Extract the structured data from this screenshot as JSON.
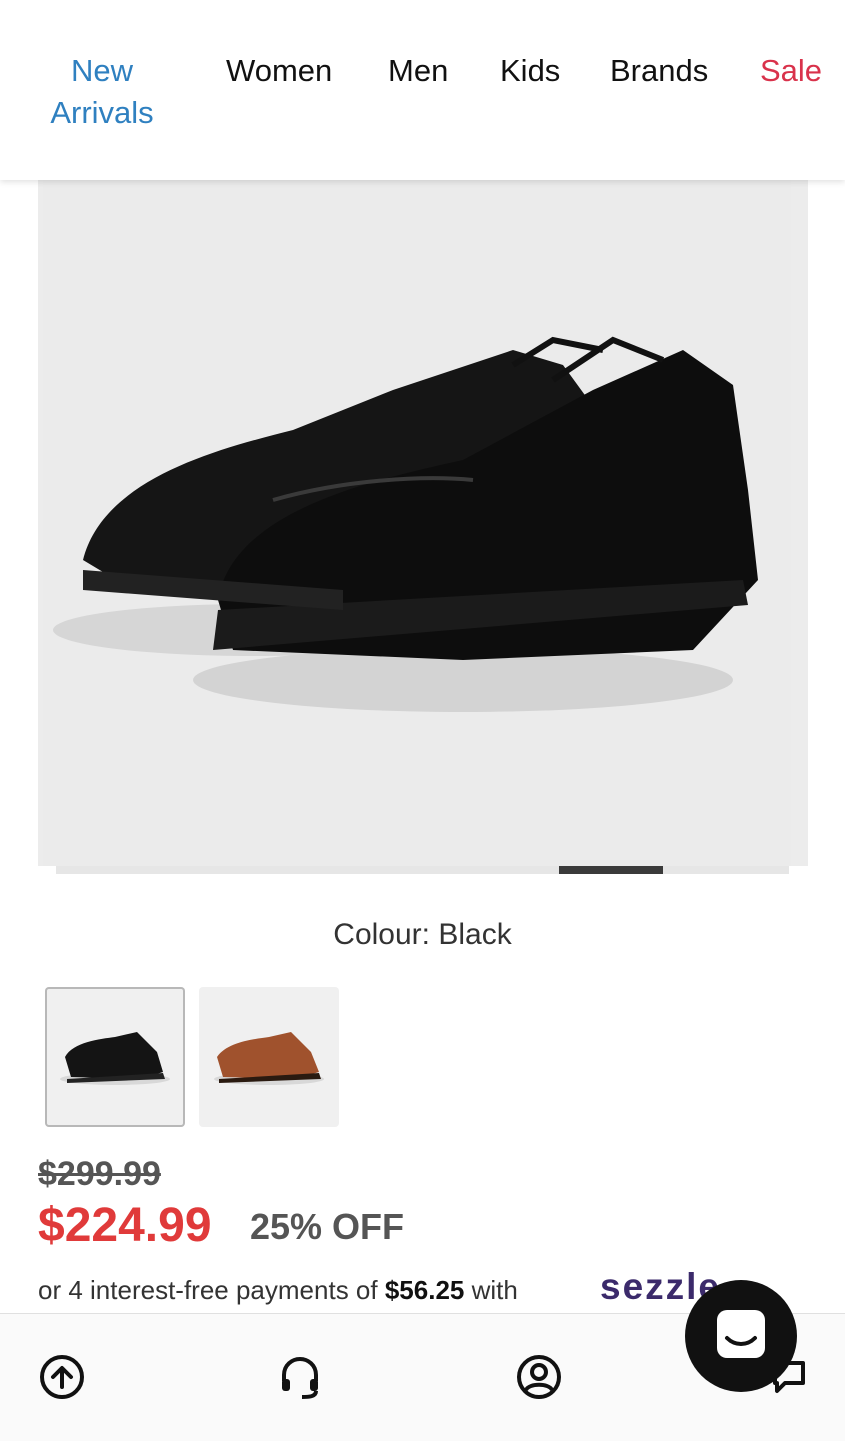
{
  "nav": {
    "items": [
      "New Arrivals",
      "Women",
      "Men",
      "Kids",
      "Brands",
      "Sale"
    ]
  },
  "product": {
    "colour_text": "Colour: Black",
    "swatches": [
      "Black",
      "Tan"
    ],
    "old_price": "$299.99",
    "new_price": "$224.99",
    "discount": "25% OFF",
    "installment_prefix": "or 4 interest-free payments of",
    "installment_amount": "$56.25",
    "installment_suffix": "with",
    "provider": "sezzle"
  },
  "gallery": {
    "progress": 0.8
  },
  "bottom_nav": {
    "icons": [
      "scroll-up-icon",
      "support-headset-icon",
      "account-icon",
      "chat-icon"
    ]
  },
  "colors": {
    "nav_new": "#2f80c0",
    "nav_sale": "#d9324b",
    "sale_price": "#e03a3a",
    "sezzle": "#3b2a6b"
  }
}
